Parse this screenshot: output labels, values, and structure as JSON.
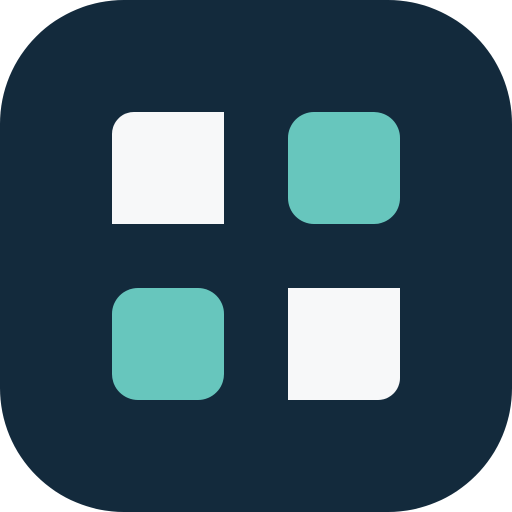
{
  "icon": {
    "name": "app-grid-icon",
    "colors": {
      "background": "#132a3c",
      "light_tile": "#f7f8f9",
      "accent_tile": "#67c6bd"
    },
    "tiles": [
      {
        "position": "top-left",
        "style": "light"
      },
      {
        "position": "top-right",
        "style": "accent"
      },
      {
        "position": "bottom-left",
        "style": "accent"
      },
      {
        "position": "bottom-right",
        "style": "light"
      }
    ]
  }
}
